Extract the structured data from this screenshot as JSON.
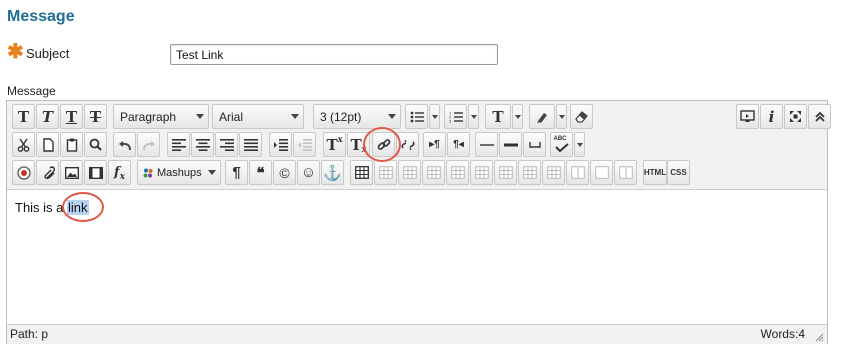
{
  "section": {
    "title": "Message"
  },
  "subject": {
    "label": "Subject",
    "value": "Test Link",
    "required_icon": "asterisk-icon"
  },
  "message": {
    "label": "Message"
  },
  "toolbar": {
    "row1": {
      "block_format": "Paragraph",
      "font_family": "Arial",
      "font_size": "3 (12pt)",
      "icons": [
        "bold-T",
        "italic-T",
        "underline-T",
        "strikethrough-T",
        "bulleted-list",
        "numbered-list",
        "text-color",
        "highlight",
        "eraser",
        "preview",
        "info",
        "fullscreen",
        "collapse"
      ]
    },
    "row2": {
      "superscript": "x",
      "subscript": "x",
      "spellcheck_label": "ABC"
    },
    "row3": {
      "mashups": "Mashups",
      "html": "HTML",
      "css": "CSS"
    }
  },
  "editor": {
    "text_before": "This is a ",
    "selected_word": "link",
    "path": "Path: p",
    "words": "Words:4"
  },
  "colors": {
    "title": "#1f6f95",
    "required": "#e8801c",
    "highlight_circle": "#e2574c",
    "selection": "#b5d4f4"
  }
}
